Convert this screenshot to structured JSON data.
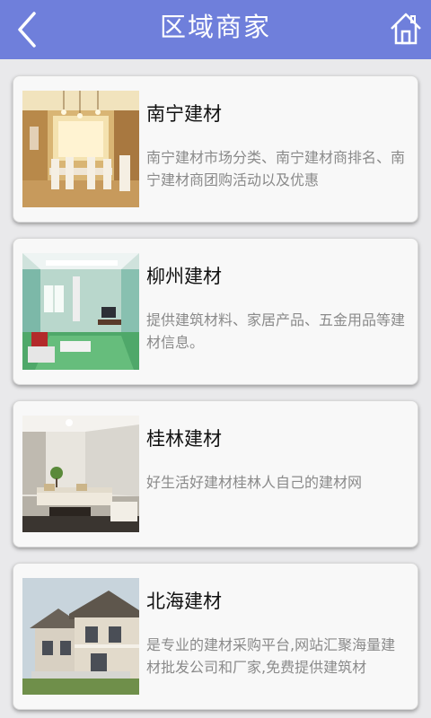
{
  "header": {
    "title": "区域商家",
    "back_icon": "back-chevron-icon",
    "home_icon": "home-icon",
    "color": "#6f7fdb"
  },
  "merchants": [
    {
      "name": "南宁建材",
      "desc": "南宁建材市场分类、南宁建材商排名、南宁建材商团购活动以及优惠",
      "image": "dining-room-photo"
    },
    {
      "name": "柳州建材",
      "desc": "提供建筑材料、家居产品、五金用品等建材信息。",
      "image": "living-room-photo"
    },
    {
      "name": "桂林建材",
      "desc": "好生活好建材桂林人自己的建材网",
      "image": "lounge-photo"
    },
    {
      "name": "北海建材",
      "desc": "是专业的建材采购平台,网站汇聚海量建材批发公司和厂家,免费提供建筑材",
      "image": "house-exterior-photo"
    }
  ]
}
